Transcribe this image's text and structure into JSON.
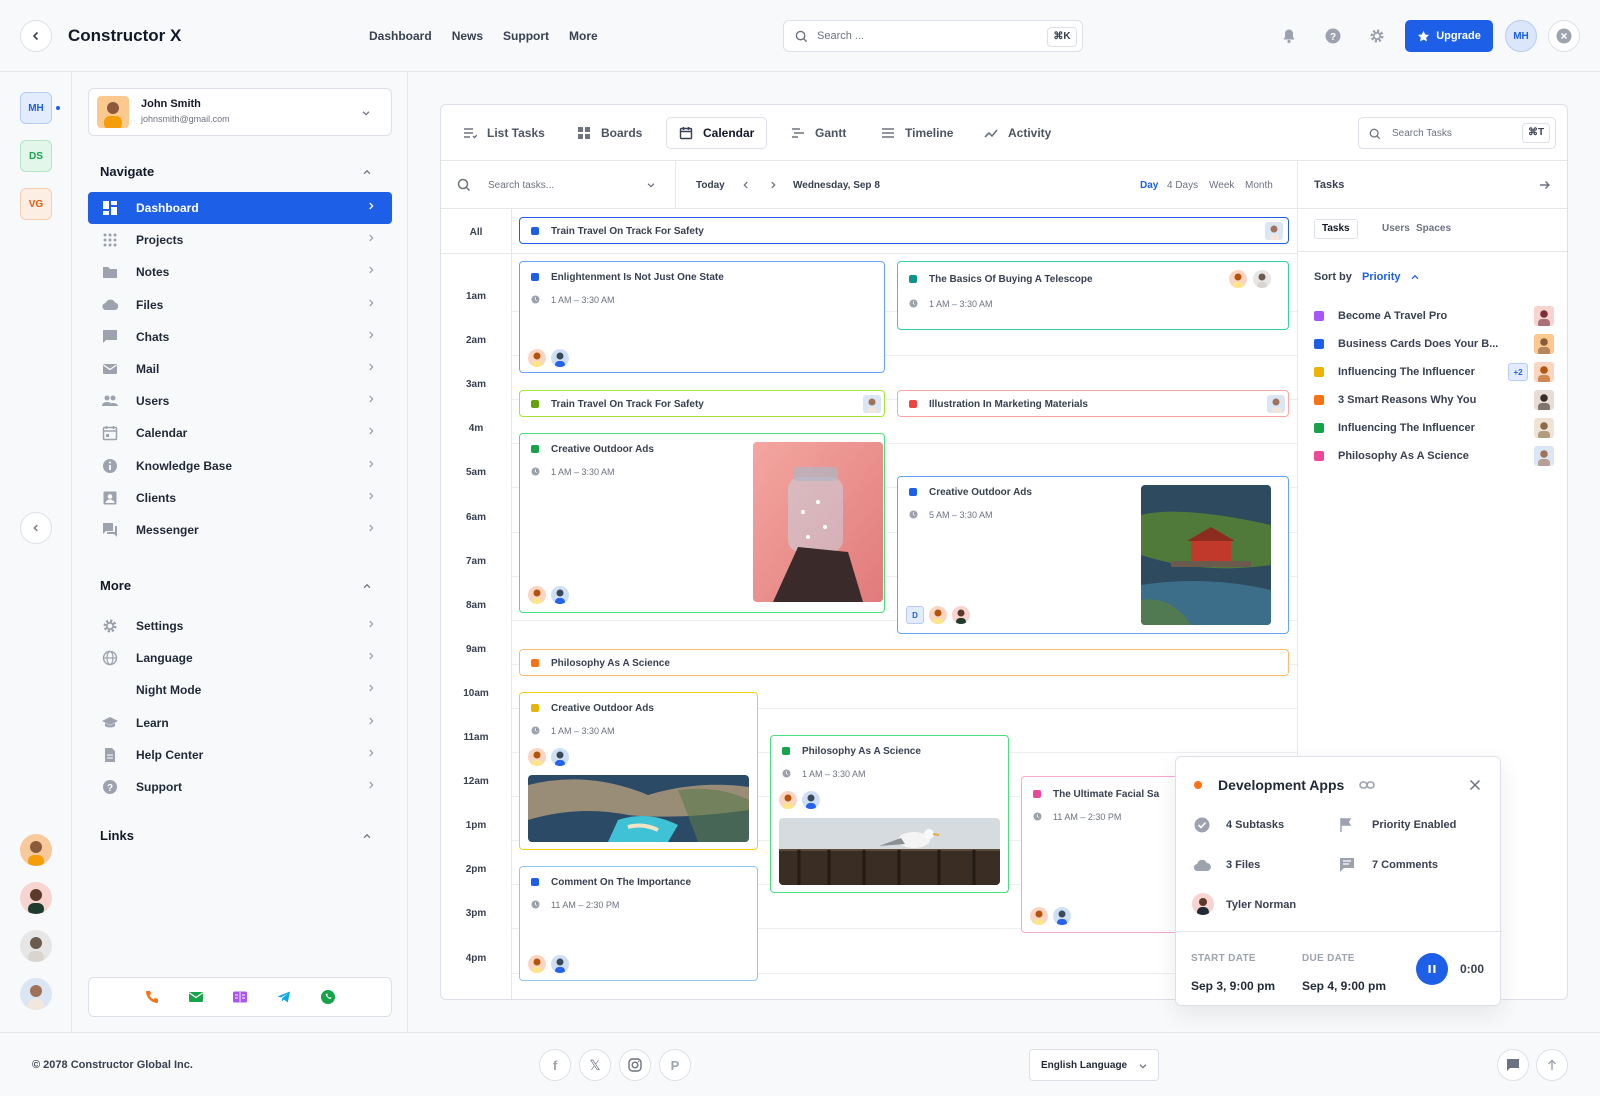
{
  "app": {
    "title": "Constructor X"
  },
  "header": {
    "nav": [
      "Dashboard",
      "News",
      "Support",
      "More"
    ],
    "search_placeholder": "Search ...",
    "search_kbd": "⌘K",
    "upgrade_label": "Upgrade",
    "user_initials": "MH"
  },
  "workspaces": [
    {
      "label": "MH",
      "color": "#1d5fe6",
      "bg": "#e3ecfd"
    },
    {
      "label": "DS",
      "color": "#16a34a",
      "bg": "#e2f6e9"
    },
    {
      "label": "VG",
      "color": "#ea580c",
      "bg": "#fdeee3"
    }
  ],
  "user": {
    "name": "John Smith",
    "email": "johnsmith@gmail.com"
  },
  "sidebar": {
    "navigate_title": "Navigate",
    "items": [
      {
        "label": "Dashboard",
        "icon": "dashboard-icon"
      },
      {
        "label": "Projects",
        "icon": "apps-icon"
      },
      {
        "label": "Notes",
        "icon": "folder-icon"
      },
      {
        "label": "Files",
        "icon": "cloud-icon"
      },
      {
        "label": "Chats",
        "icon": "chat-icon"
      },
      {
        "label": "Mail",
        "icon": "mail-icon"
      },
      {
        "label": "Users",
        "icon": "users-icon"
      },
      {
        "label": "Calendar",
        "icon": "calendar-icon"
      },
      {
        "label": "Knowledge Base",
        "icon": "info-icon"
      },
      {
        "label": "Clients",
        "icon": "contact-icon"
      },
      {
        "label": "Messenger",
        "icon": "forum-icon"
      }
    ],
    "more_title": "More",
    "more_items": [
      {
        "label": "Settings",
        "icon": "gear-icon"
      },
      {
        "label": "Language",
        "icon": "globe-icon"
      },
      {
        "label": "Night Mode",
        "icon": "moon-icon"
      },
      {
        "label": "Learn",
        "icon": "school-icon"
      },
      {
        "label": "Help Center",
        "icon": "document-icon"
      },
      {
        "label": "Support",
        "icon": "help-icon"
      }
    ],
    "links_title": "Links"
  },
  "tabs": [
    {
      "label": "List Tasks",
      "icon": "list-icon"
    },
    {
      "label": "Boards",
      "icon": "boards-icon"
    },
    {
      "label": "Calendar",
      "icon": "calendar-icon"
    },
    {
      "label": "Gantt",
      "icon": "gantt-icon"
    },
    {
      "label": "Timeline",
      "icon": "timeline-icon"
    },
    {
      "label": "Activity",
      "icon": "activity-icon"
    }
  ],
  "task_search": {
    "placeholder": "Search Tasks",
    "kbd": "⌘T"
  },
  "calendar": {
    "search_placeholder": "Search tasks...",
    "today_label": "Today",
    "date_label": "Wednesday, Sep 8",
    "views": [
      "Day",
      "4 Days",
      "Week",
      "Month"
    ],
    "active_view": "Day",
    "all_label": "All",
    "hours": [
      "1am",
      "2am",
      "3am",
      "4m",
      "5am",
      "6am",
      "7am",
      "8am",
      "9am",
      "10am",
      "11am",
      "12am",
      "1pm",
      "2pm",
      "3pm",
      "4pm"
    ],
    "events": {
      "allday": {
        "title": "Train Travel On Track For Safety",
        "color": "#1d5fe6"
      },
      "e1": {
        "title": "Enlightenment Is Not Just One State",
        "time": "1 AM – 3:30 AM",
        "color": "#1d5fe6"
      },
      "e2": {
        "title": "The Basics Of Buying A Telescope",
        "time": "1 AM – 3:30 AM",
        "color": "#0d9488"
      },
      "e3": {
        "title": "Train Travel On Track For Safety",
        "color": "#65a30d"
      },
      "e4": {
        "title": "Illustration In Marketing Materials",
        "color": "#ef4444"
      },
      "e5": {
        "title": "Creative Outdoor Ads",
        "time": "1 AM – 3:30 AM",
        "color": "#16a34a"
      },
      "e6": {
        "title": "Creative Outdoor Ads",
        "time": "5 AM – 3:30 AM",
        "color": "#1d5fe6",
        "badge": "D"
      },
      "e7": {
        "title": "Philosophy As A Science",
        "color": "#f97316"
      },
      "e8": {
        "title": "Creative Outdoor Ads",
        "time": "1 AM – 3:30 AM",
        "color": "#eab308"
      },
      "e9": {
        "title": "Philosophy As A Science",
        "time": "1 AM – 3:30 AM",
        "color": "#16a34a"
      },
      "e10": {
        "title": "The Ultimate Facial Sa",
        "time": "11 AM – 2:30 PM",
        "color": "#ec4899"
      },
      "e11": {
        "title": "Comment On The Importance",
        "time": "11 AM – 2:30 PM",
        "color": "#1d5fe6"
      }
    }
  },
  "tasks_panel": {
    "title": "Tasks",
    "tabs": [
      "Tasks",
      "Users",
      "Spaces"
    ],
    "sort_label": "Sort by",
    "sort_value": "Priority",
    "items": [
      {
        "label": "Become A Travel Pro",
        "color": "#a855f7"
      },
      {
        "label": "Business Cards Does Your B...",
        "color": "#1d5fe6"
      },
      {
        "label": "Influencing The Influencer",
        "color": "#eab308",
        "badge": "+2"
      },
      {
        "label": "3 Smart Reasons Why You",
        "color": "#f97316"
      },
      {
        "label": "Influencing The Influencer",
        "color": "#16a34a"
      },
      {
        "label": "Philosophy As A Science",
        "color": "#ec4899"
      }
    ]
  },
  "popup": {
    "title": "Development Apps",
    "subtasks": "4 Subtasks",
    "priority": "Priority Enabled",
    "files": "3 Files",
    "comments": "7 Comments",
    "assignee": "Tyler Norman",
    "start_label": "START DATE",
    "start_value": "Sep 3, 9:00 pm",
    "due_label": "DUE DATE",
    "due_value": "Sep 4, 9:00 pm",
    "timer": "0:00"
  },
  "footer": {
    "copyright": "© 2078 Constructor Global Inc.",
    "language": "English Language"
  }
}
